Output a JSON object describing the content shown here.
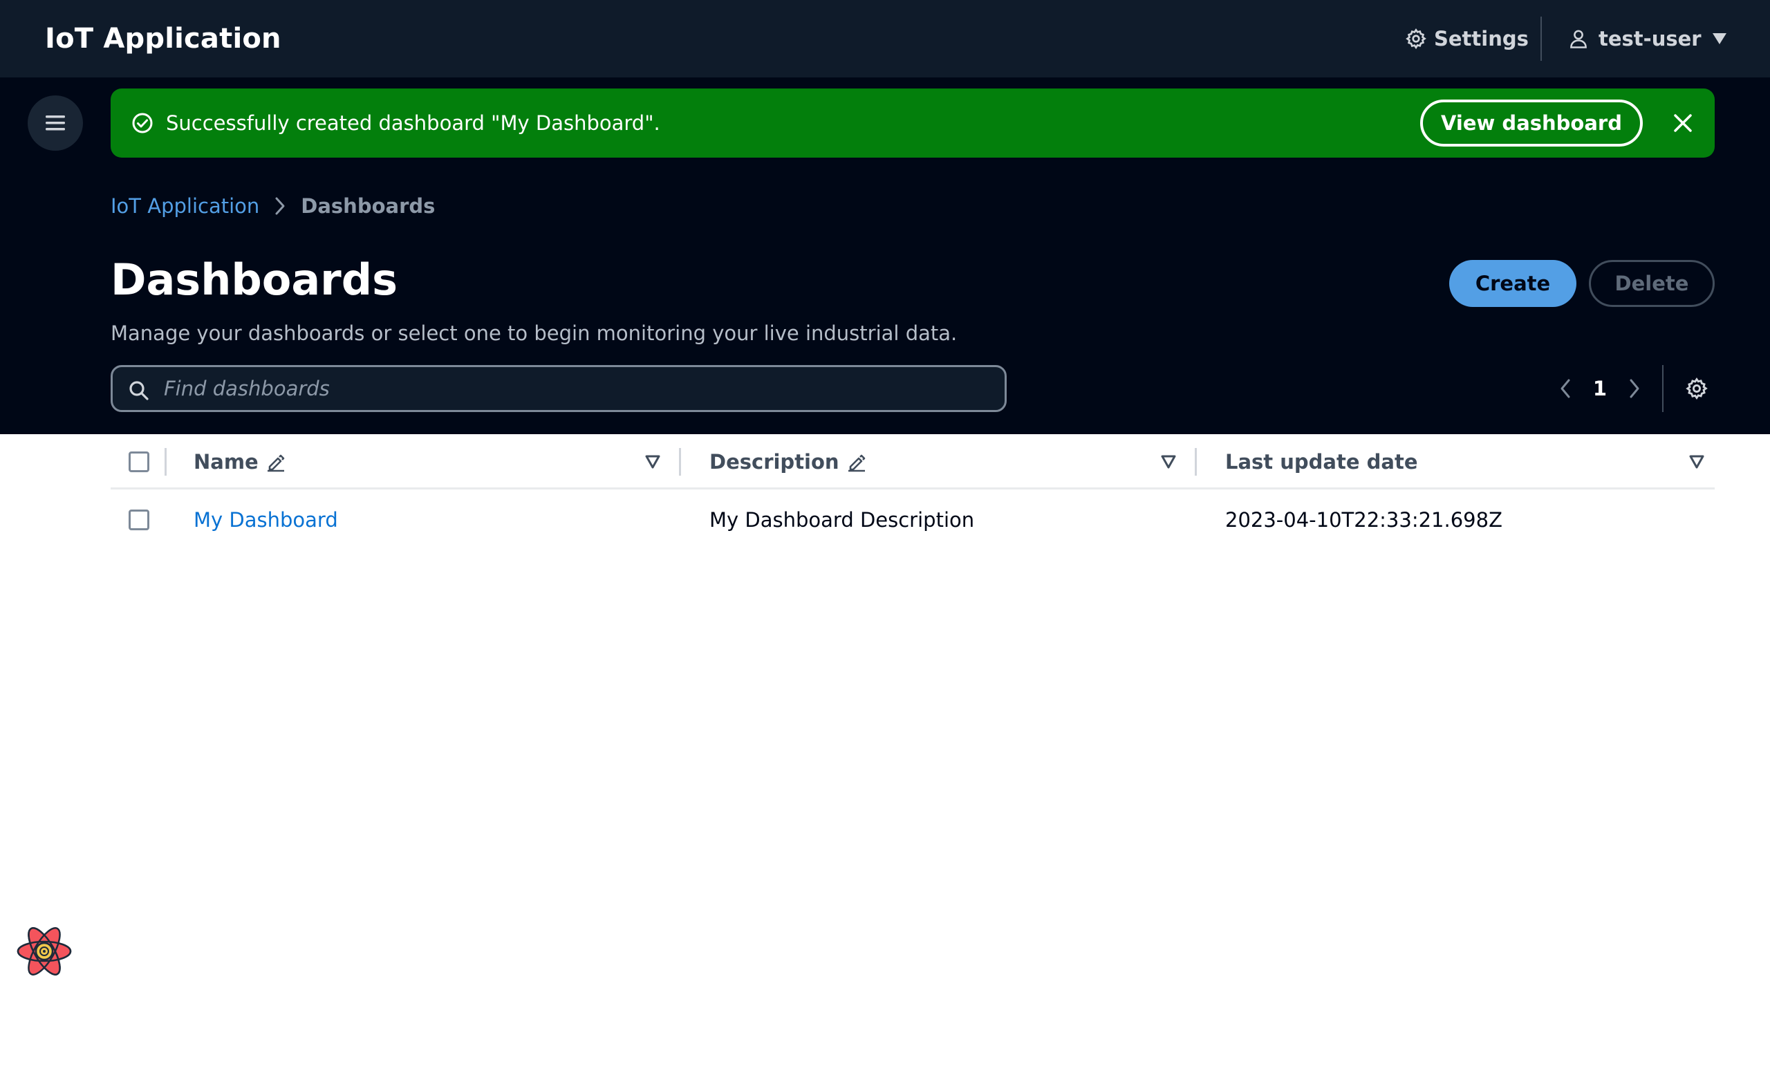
{
  "topnav": {
    "title": "IoT Application",
    "settings_label": "Settings",
    "user_label": "test-user"
  },
  "flash": {
    "message": "Successfully created dashboard \"My Dashboard\".",
    "action_label": "View dashboard",
    "color": "#037f0c"
  },
  "breadcrumb": {
    "items": [
      "IoT Application",
      "Dashboards"
    ]
  },
  "page": {
    "title": "Dashboards",
    "description": "Manage your dashboards or select one to begin monitoring your live industrial data.",
    "create_label": "Create",
    "delete_label": "Delete"
  },
  "search": {
    "placeholder": "Find dashboards"
  },
  "pagination": {
    "current_page": "1"
  },
  "table": {
    "columns": [
      "Name",
      "Description",
      "Last update date"
    ],
    "rows": [
      {
        "name": "My Dashboard",
        "description": "My Dashboard Description",
        "last_update": "2023-04-10T22:33:21.698Z"
      }
    ]
  },
  "colors": {
    "nav_bg": "#0f1b2a",
    "header_bg": "#000716",
    "accent": "#539fe5",
    "link": "#0972d3"
  }
}
